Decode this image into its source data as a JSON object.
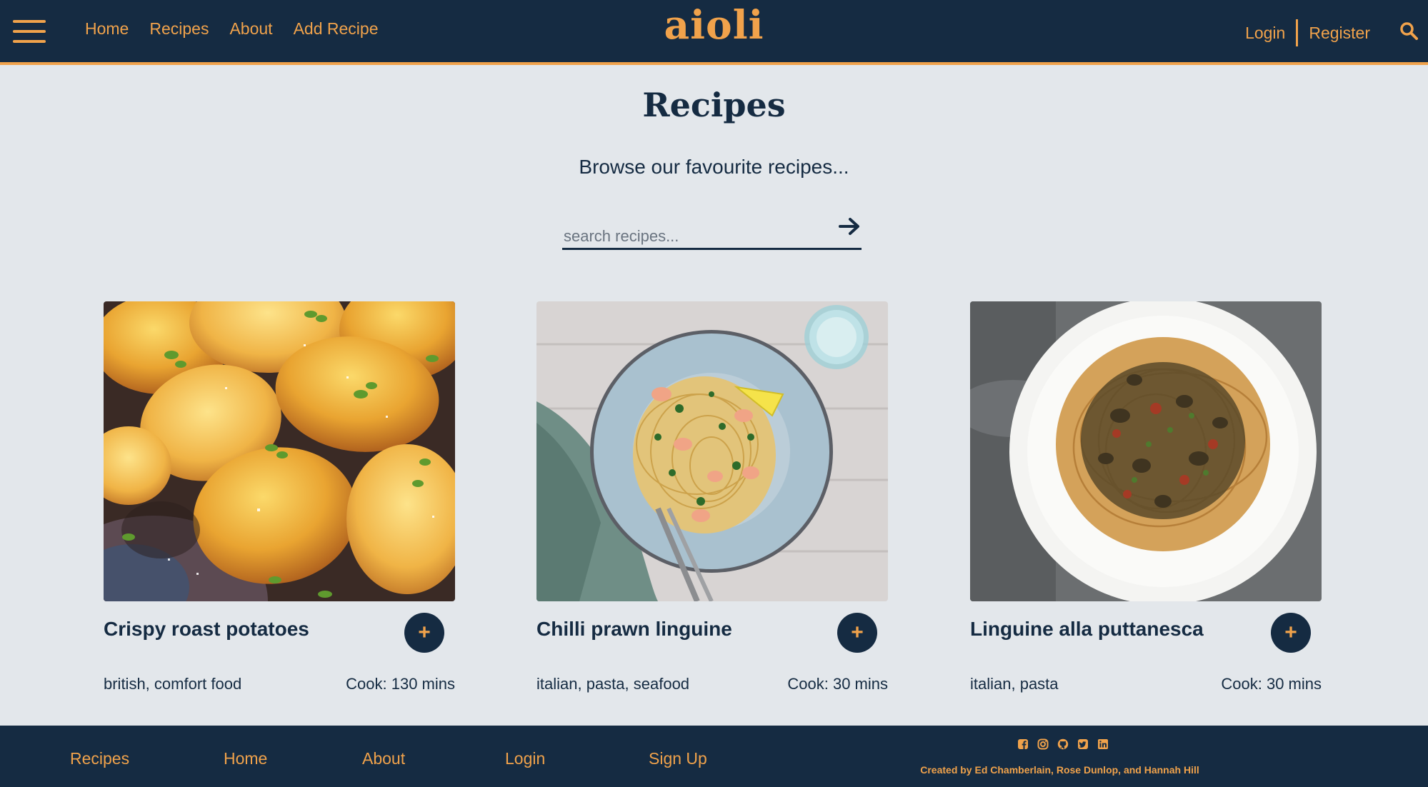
{
  "header": {
    "logo": "aioli",
    "nav": [
      "Home",
      "Recipes",
      "About",
      "Add Recipe"
    ],
    "login": "Login",
    "register": "Register"
  },
  "main": {
    "title": "Recipes",
    "subtitle": "Browse our favourite recipes...",
    "search_placeholder": "search recipes..."
  },
  "recipes": [
    {
      "title": "Crispy roast potatoes",
      "tags": "british, comfort food",
      "cook": "Cook: 130 mins",
      "add_label": "+"
    },
    {
      "title": "Chilli prawn linguine",
      "tags": "italian, pasta, seafood",
      "cook": "Cook: 30 mins",
      "add_label": "+"
    },
    {
      "title": "Linguine alla puttanesca",
      "tags": "italian, pasta",
      "cook": "Cook: 30 mins",
      "add_label": "+"
    }
  ],
  "footer": {
    "links": [
      "Recipes",
      "Home",
      "About",
      "Login",
      "Sign Up"
    ],
    "social_icons": [
      "facebook-icon",
      "instagram-icon",
      "github-icon",
      "twitter-icon",
      "linkedin-icon"
    ],
    "credit": "Created by Ed Chamberlain, Rose Dunlop, and Hannah Hill"
  },
  "colors": {
    "navy": "#152b42",
    "accent": "#f0a24b",
    "background": "#e3e7eb"
  }
}
